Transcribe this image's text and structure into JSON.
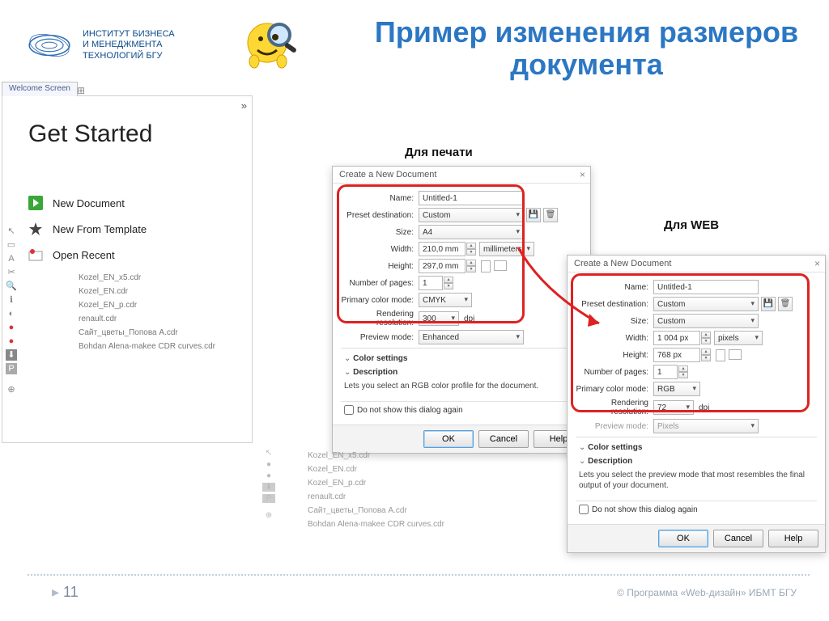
{
  "header": {
    "institute_line1": "ИНСТИТУТ БИЗНЕСА",
    "institute_line2": "И МЕНЕДЖМЕНТА",
    "institute_line3": "ТЕХНОЛОГИЙ БГУ",
    "title": "Пример изменения размеров документа"
  },
  "panel_labels": {
    "print": "Для печати",
    "web": "Для WEB"
  },
  "get_started": {
    "tab": "Welcome Screen",
    "collapse": "»",
    "heading": "Get Started",
    "items": {
      "new_doc": "New Document",
      "new_tpl": "New From Template",
      "open_recent": "Open Recent"
    },
    "recent": [
      "Kozel_EN_x5.cdr",
      "Kozel_EN.cdr",
      "Kozel_EN_p.cdr",
      "renault.cdr",
      "Сайт_цветы_Попова A.cdr",
      "Bohdan Alena-makee CDR curves.cdr"
    ]
  },
  "dialog_common": {
    "title": "Create a New Document",
    "labels": {
      "name": "Name:",
      "preset": "Preset destination:",
      "size": "Size:",
      "width": "Width:",
      "height": "Height:",
      "pages": "Number of pages:",
      "color": "Primary color mode:",
      "res": "Rendering resolution:",
      "preview": "Preview mode:",
      "dpi": "dpi"
    },
    "sections": {
      "color": "Color settings",
      "desc": "Description"
    },
    "checkbox": "Do not show this dialog again",
    "buttons": {
      "ok": "OK",
      "cancel": "Cancel",
      "help": "Help"
    }
  },
  "dialog_print": {
    "name": "Untitled-1",
    "preset": "Custom",
    "size": "A4",
    "width": "210,0 mm",
    "units": "millimeters",
    "height": "297,0 mm",
    "pages": "1",
    "color": "CMYK",
    "res": "300",
    "preview": "Enhanced",
    "desc": "Lets you select an RGB color profile for the document."
  },
  "dialog_web": {
    "name": "Untitled-1",
    "preset": "Custom",
    "size": "Custom",
    "width": "1 004 px",
    "units": "pixels",
    "height": "768 px",
    "pages": "1",
    "color": "RGB",
    "res": "72",
    "preview": "Pixels",
    "desc": "Lets you select the preview mode that most resembles the final output of your document."
  },
  "footer": {
    "page": "11",
    "copyright": "© Программа «Web-дизайн» ИБМТ БГУ"
  }
}
